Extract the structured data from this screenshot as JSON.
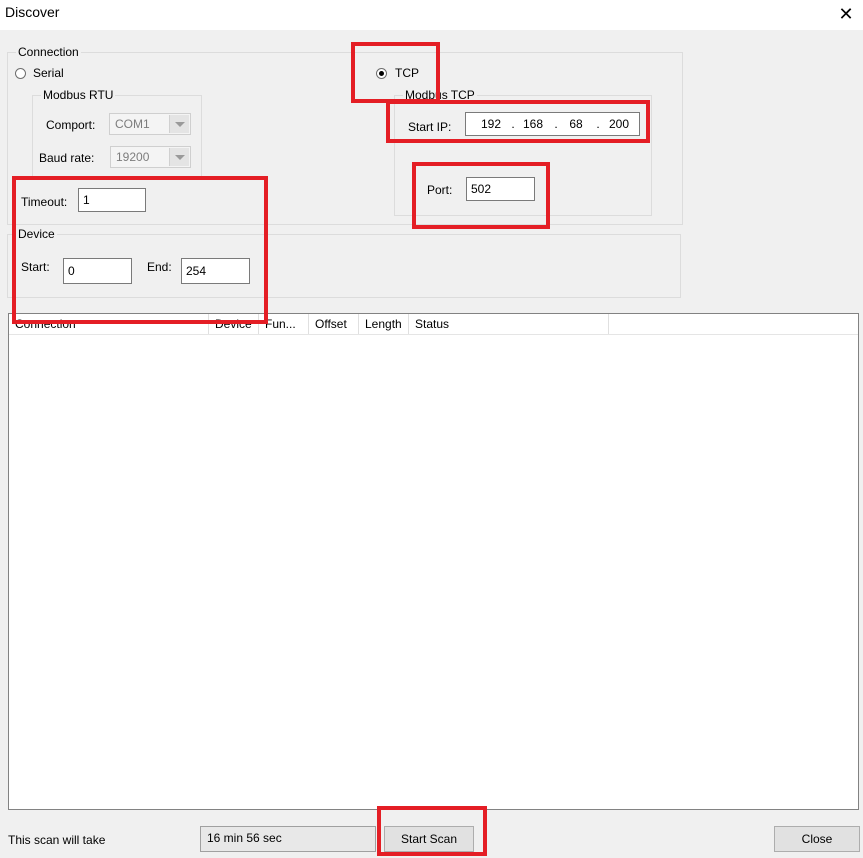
{
  "window": {
    "title": "Discover",
    "close_glyph": "✕"
  },
  "connection": {
    "legend": "Connection",
    "serial": {
      "label": "Serial",
      "checked": false
    },
    "tcp": {
      "label": "TCP",
      "checked": true
    },
    "modbus_rtu": {
      "legend": "Modbus RTU",
      "comport_label": "Comport:",
      "comport_value": "COM1",
      "baud_label": "Baud rate:",
      "baud_value": "19200"
    },
    "modbus_tcp": {
      "legend": "Modbus TCP",
      "start_ip_label": "Start IP:",
      "ip": [
        "192",
        "168",
        "68",
        "200"
      ],
      "dot": ".",
      "port_label": "Port:",
      "port_value": "502"
    },
    "timeout_label": "Timeout:",
    "timeout_value": "1"
  },
  "device": {
    "legend": "Device",
    "start_label": "Start:",
    "start_value": "0",
    "end_label": "End:",
    "end_value": "254"
  },
  "results": {
    "columns": [
      "Connection",
      "Device",
      "Fun...",
      "Offset",
      "Length",
      "Status"
    ],
    "rows": []
  },
  "footer": {
    "scan_label": "This scan will take",
    "scan_time": "16 min 56 sec",
    "start_scan": "Start Scan",
    "close": "Close"
  },
  "annotation_color": "#e41e25"
}
